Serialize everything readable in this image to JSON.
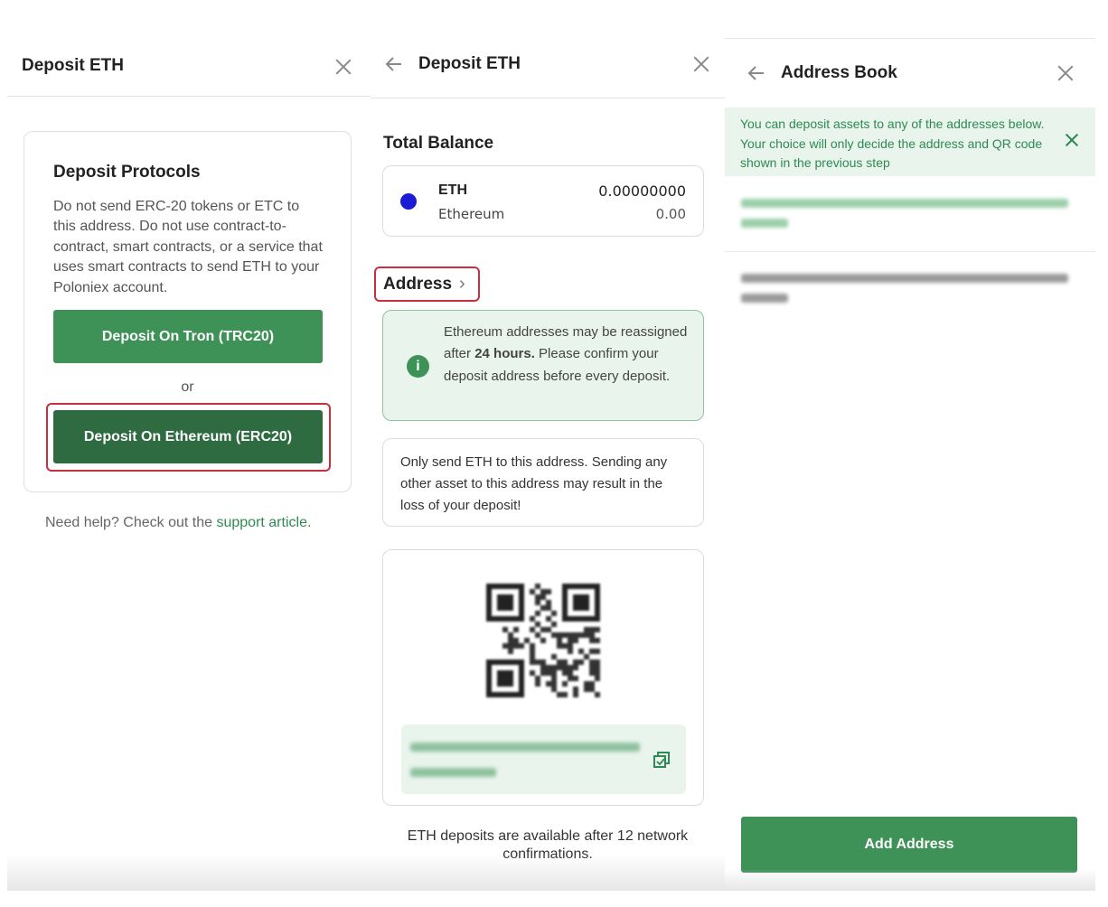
{
  "deposit_panel": {
    "title": "Deposit ETH",
    "protocols_title": "Deposit Protocols",
    "protocols_text": "Do not send ERC-20 tokens or ETC to this address. Do not use contract-to-contract, smart contracts, or a service that uses smart contracts to send ETH to your Poloniex account.",
    "tron_button": "Deposit On Tron (TRC20)",
    "or_label": "or",
    "ethereum_button": "Deposit On Ethereum (ERC20)",
    "help_text": "Need help? Check out the ",
    "help_link": "support article",
    "help_end": "."
  },
  "address_panel": {
    "title": "Deposit ETH",
    "total_balance_label": "Total Balance",
    "coin_symbol": "ETH",
    "coin_name": "Ethereum",
    "balance": "0.00000000",
    "balance_fiat": "0.00",
    "address_label": "Address",
    "info_before": "Ethereum addresses may be reassigned after ",
    "info_bold": "24 hours.",
    "info_after": " Please confirm your deposit address before every deposit.",
    "warning": "Only send ETH to this address. Sending any other asset to this address may result in the loss of your deposit!",
    "footnote": "ETH deposits are available after 12 network confirmations.",
    "colors": {
      "eth_dot": "#1b1bd6",
      "info_bg": "#e9f4ec"
    }
  },
  "address_book_panel": {
    "title": "Address Book",
    "banner": "You can deposit assets to any of the addresses below. Your choice will only decide the address and QR code shown in the previous step",
    "add_button": "Add Address"
  },
  "icons": [
    "close-icon",
    "back-arrow-icon",
    "chevron-right-icon",
    "info-icon",
    "copy-icon",
    "qr-code"
  ],
  "colors": {
    "primary_green": "#3e9157",
    "dark_green": "#2e6b41",
    "highlight_red": "#c8303f",
    "link_green": "#2e8a52"
  }
}
